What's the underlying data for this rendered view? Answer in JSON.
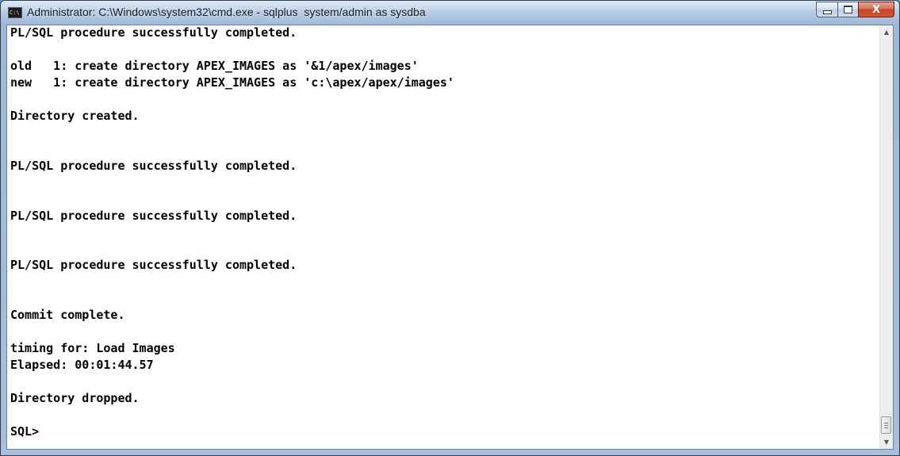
{
  "window": {
    "title": "Administrator: C:\\Windows\\system32\\cmd.exe - sqlplus  system/admin as sysdba",
    "icon": "cmd-icon",
    "icon_text": "C:\\",
    "buttons": {
      "minimize": "minimize-icon",
      "maximize": "maximize-icon",
      "close_label": "X"
    }
  },
  "console": {
    "lines": [
      "PL/SQL procedure successfully completed.",
      "",
      "old   1: create directory APEX_IMAGES as '&1/apex/images'",
      "new   1: create directory APEX_IMAGES as 'c:\\apex/apex/images'",
      "",
      "Directory created.",
      "",
      "",
      "PL/SQL procedure successfully completed.",
      "",
      "",
      "PL/SQL procedure successfully completed.",
      "",
      "",
      "PL/SQL procedure successfully completed.",
      "",
      "",
      "Commit complete.",
      "",
      "timing for: Load Images",
      "Elapsed: 00:01:44.57",
      "",
      "Directory dropped.",
      "",
      "SQL>"
    ]
  },
  "scrollbar": {
    "up_arrow": "▲",
    "down_arrow": "▼"
  },
  "colors": {
    "console_background": "#ffffff",
    "console_text": "#000000",
    "close_button": "#c5462a"
  }
}
